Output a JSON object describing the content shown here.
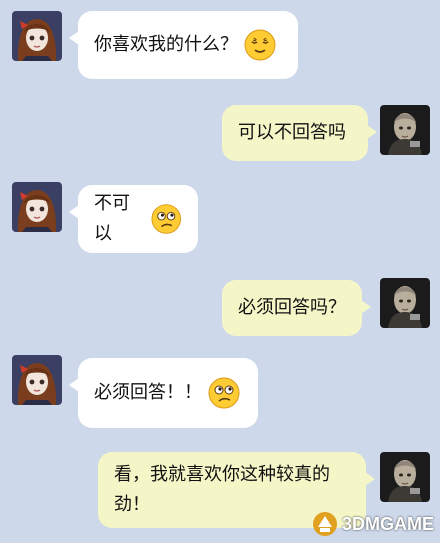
{
  "colors": {
    "background": "#cdd8ea",
    "incoming_bubble": "#ffffff",
    "outgoing_bubble": "#f5f6c8"
  },
  "messages": [
    {
      "side": "left",
      "text": "你喜欢我的什么？",
      "emoji": "smiling-closed-eyes-emoji"
    },
    {
      "side": "right",
      "text": "可以不回答吗"
    },
    {
      "side": "left",
      "text": "不可以",
      "emoji": "thinking-emoji"
    },
    {
      "side": "right",
      "text": "必须回答吗？"
    },
    {
      "side": "left",
      "text": "必须回答！！",
      "emoji": "thinking-emoji"
    },
    {
      "side": "right",
      "text_line1": "看，我就喜欢你这种较真的",
      "text_line2": "劲！"
    }
  ],
  "watermark": {
    "text": "3DMGAME"
  }
}
